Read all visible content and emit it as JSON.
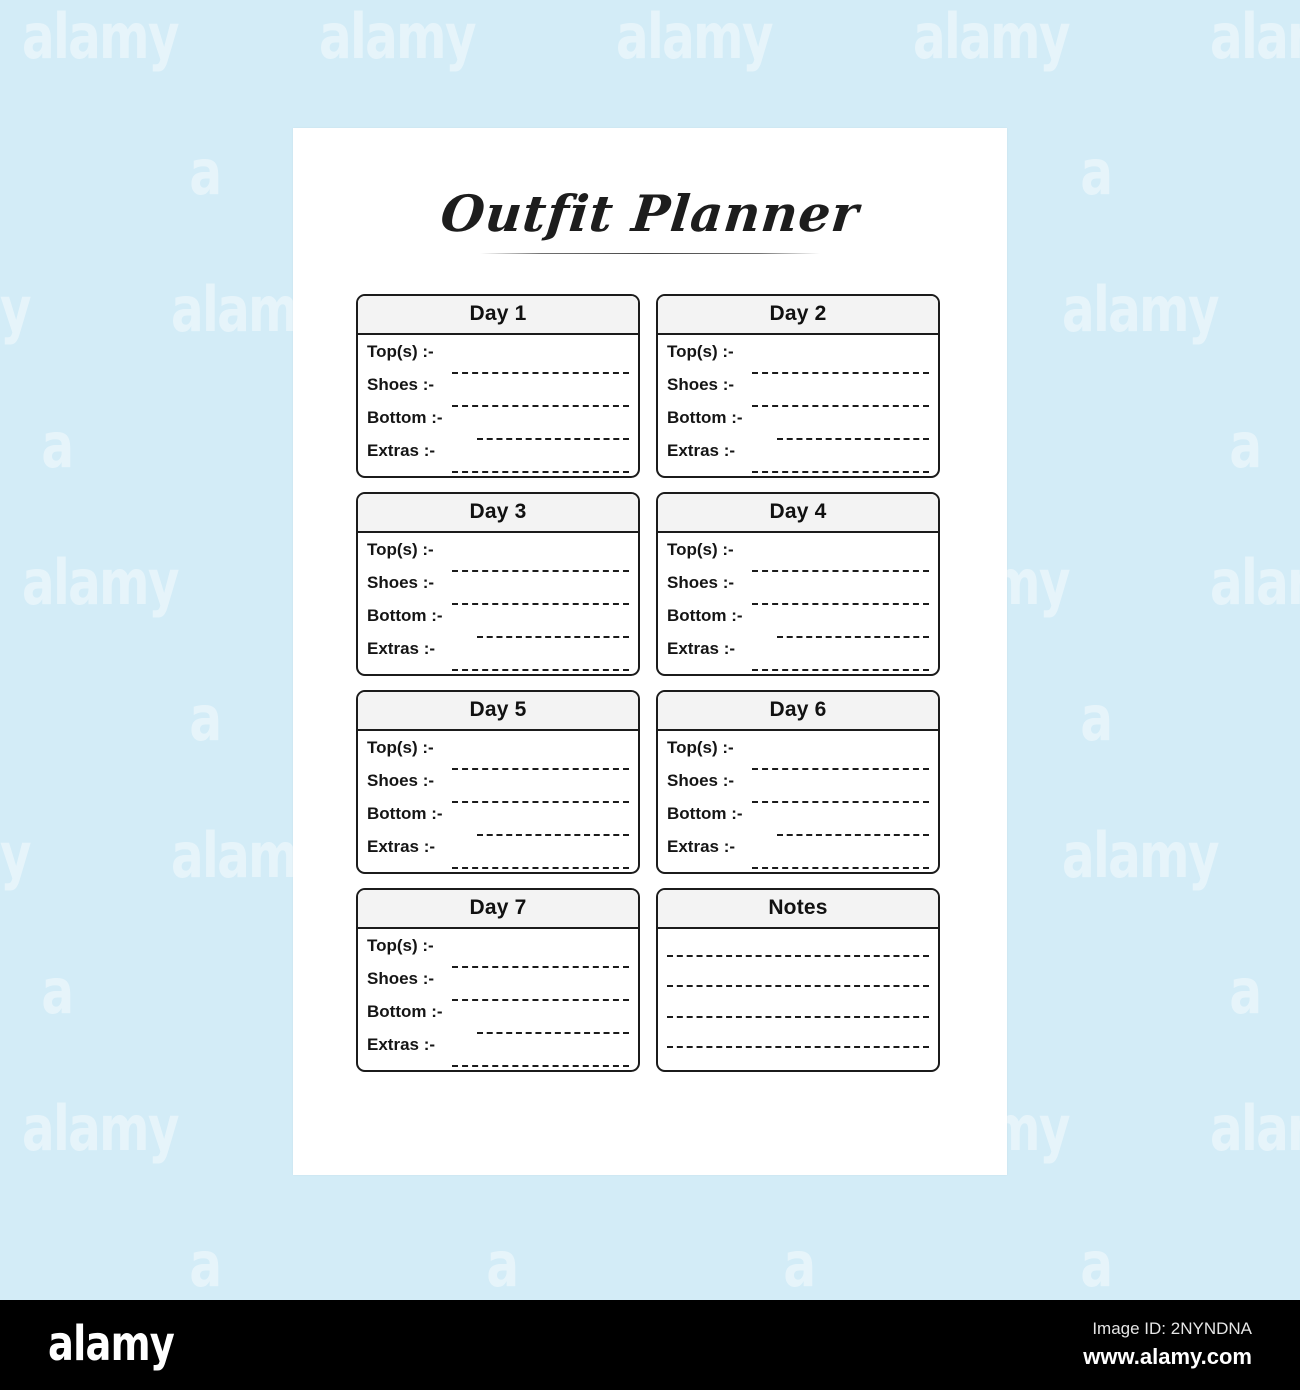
{
  "canvas": {
    "background_color": "#d3ecf7",
    "page_background": "#ffffff"
  },
  "watermark": {
    "word": "alamy",
    "letter": "a",
    "color": "#ffffff"
  },
  "planner": {
    "title": "Outfit Planner",
    "field_labels": {
      "tops": "Top(s) :-",
      "shoes": "Shoes :-",
      "bottom": "Bottom :-",
      "extras": "Extras :-"
    },
    "cards": [
      {
        "id": "day-1",
        "header": "Day 1",
        "fields": [
          {
            "label": "Top(s) :-",
            "value": "",
            "rule": "short"
          },
          {
            "label": "Shoes :-",
            "value": "",
            "rule": "short"
          },
          {
            "label": "Bottom :-",
            "value": "",
            "rule": "long"
          },
          {
            "label": "Extras :-",
            "value": "",
            "rule": "short"
          }
        ]
      },
      {
        "id": "day-2",
        "header": "Day 2",
        "fields": [
          {
            "label": "Top(s) :-",
            "value": "",
            "rule": "short"
          },
          {
            "label": "Shoes :-",
            "value": "",
            "rule": "short"
          },
          {
            "label": "Bottom :-",
            "value": "",
            "rule": "long"
          },
          {
            "label": "Extras :-",
            "value": "",
            "rule": "short"
          }
        ]
      },
      {
        "id": "day-3",
        "header": "Day 3",
        "fields": [
          {
            "label": "Top(s) :-",
            "value": "",
            "rule": "short"
          },
          {
            "label": "Shoes :-",
            "value": "",
            "rule": "short"
          },
          {
            "label": "Bottom :-",
            "value": "",
            "rule": "long"
          },
          {
            "label": "Extras :-",
            "value": "",
            "rule": "short"
          }
        ]
      },
      {
        "id": "day-4",
        "header": "Day 4",
        "fields": [
          {
            "label": "Top(s) :-",
            "value": "",
            "rule": "short"
          },
          {
            "label": "Shoes :-",
            "value": "",
            "rule": "short"
          },
          {
            "label": "Bottom :-",
            "value": "",
            "rule": "long"
          },
          {
            "label": "Extras :-",
            "value": "",
            "rule": "short"
          }
        ]
      },
      {
        "id": "day-5",
        "header": "Day 5",
        "fields": [
          {
            "label": "Top(s) :-",
            "value": "",
            "rule": "short"
          },
          {
            "label": "Shoes :-",
            "value": "",
            "rule": "short"
          },
          {
            "label": "Bottom :-",
            "value": "",
            "rule": "long"
          },
          {
            "label": "Extras :-",
            "value": "",
            "rule": "short"
          }
        ]
      },
      {
        "id": "day-6",
        "header": "Day 6",
        "fields": [
          {
            "label": "Top(s) :-",
            "value": "",
            "rule": "short"
          },
          {
            "label": "Shoes :-",
            "value": "",
            "rule": "short"
          },
          {
            "label": "Bottom :-",
            "value": "",
            "rule": "long"
          },
          {
            "label": "Extras :-",
            "value": "",
            "rule": "short"
          }
        ]
      },
      {
        "id": "day-7",
        "header": "Day 7",
        "fields": [
          {
            "label": "Top(s) :-",
            "value": "",
            "rule": "short"
          },
          {
            "label": "Shoes :-",
            "value": "",
            "rule": "short"
          },
          {
            "label": "Bottom :-",
            "value": "",
            "rule": "long"
          },
          {
            "label": "Extras :-",
            "value": "",
            "rule": "short"
          }
        ]
      },
      {
        "id": "notes",
        "header": "Notes",
        "note_lines": 4
      }
    ]
  },
  "footer": {
    "logo_text": "alamy",
    "image_id_label": "Image ID: 2NYNDNA",
    "website": "www.alamy.com",
    "background_color": "#000000"
  }
}
